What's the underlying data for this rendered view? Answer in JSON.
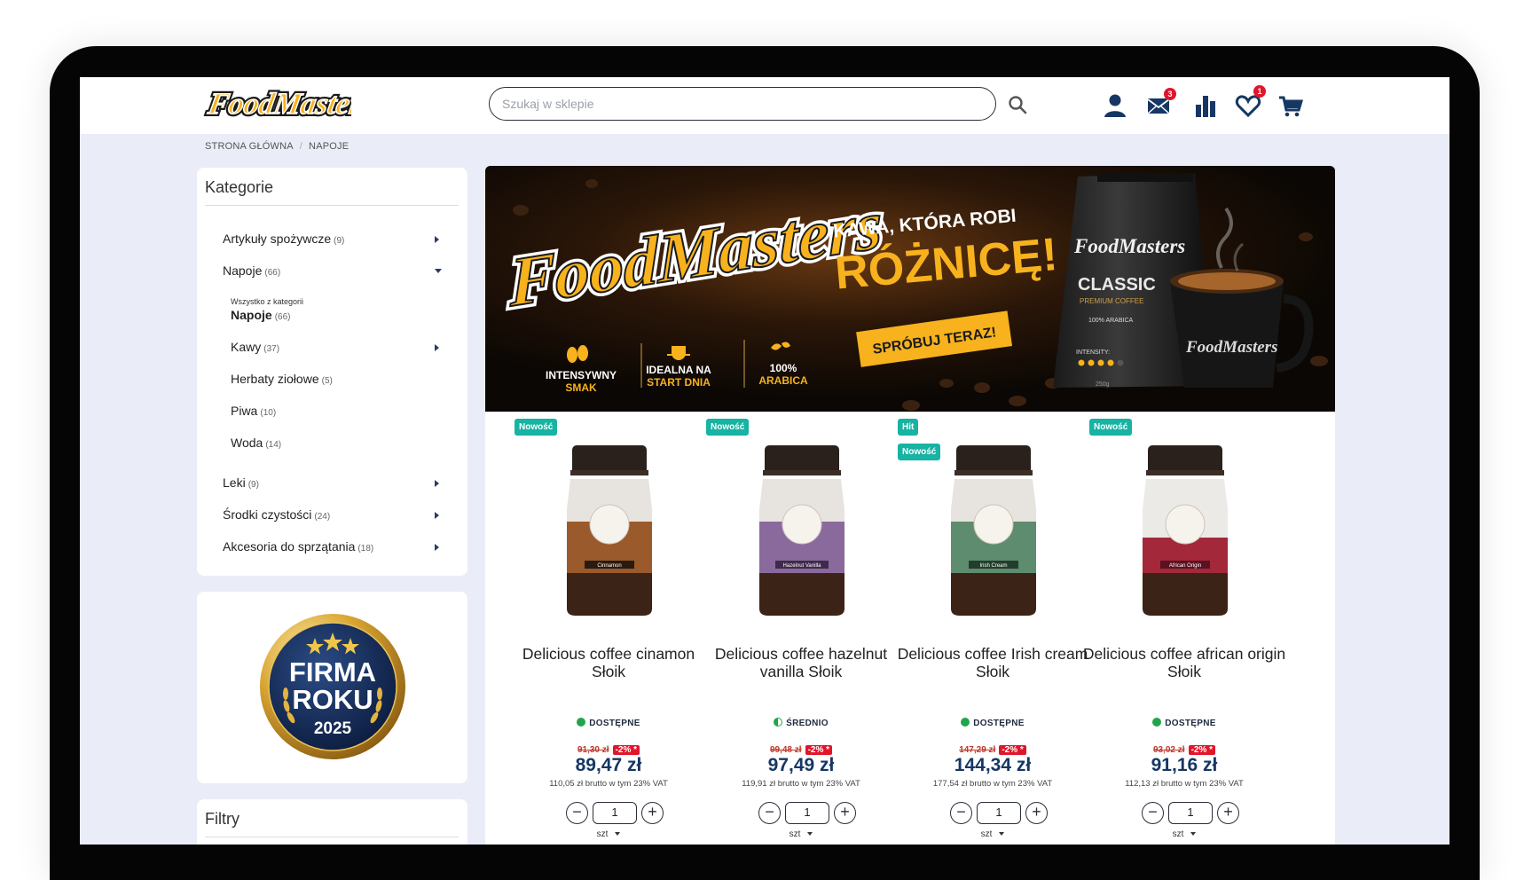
{
  "search": {
    "placeholder": "Szukaj w sklepie"
  },
  "header": {
    "icons": [
      "user-icon",
      "envelope-icon",
      "chart-icon",
      "heart-icon",
      "cart-icon"
    ],
    "messages_count": "3",
    "wishlist_count": "1"
  },
  "breadcrumb": {
    "home": "STRONA GŁÓWNA",
    "current": "NAPOJE"
  },
  "sidebar": {
    "title": "Kategorie",
    "categories": [
      {
        "label": "Artykuły spożywcze",
        "count": "(9)"
      },
      {
        "label": "Napoje",
        "count": "(66)"
      },
      {
        "label": "Leki",
        "count": "(9)"
      },
      {
        "label": "Środki czystości",
        "count": "(24)"
      },
      {
        "label": "Akcesoria do sprzątania",
        "count": "(18)"
      }
    ],
    "all_in_category": "Wszystko z kategorii",
    "all_name": "Napoje",
    "all_count": "(66)",
    "subcategories": [
      {
        "label": "Kawy",
        "count": "(37)"
      },
      {
        "label": "Herbaty ziołowe",
        "count": "(5)"
      },
      {
        "label": "Piwa",
        "count": "(10)"
      },
      {
        "label": "Woda",
        "count": "(14)"
      }
    ],
    "award": {
      "line1": "FIRMA",
      "line2": "ROKU",
      "year": "2025"
    },
    "filters_title": "Filtry"
  },
  "banner": {
    "logo": "FoodMasters",
    "headline1": "KAWA, KTÓRA ROBI",
    "headline2": "RÓŻNICĘ!",
    "cta": "SPRÓBUJ TERAZ!",
    "features": [
      {
        "line1": "INTENSYWNY",
        "line2": "SMAK"
      },
      {
        "line1": "IDEALNA NA",
        "line2": "START DNIA"
      },
      {
        "line1": "100%",
        "line2": "ARABICA"
      }
    ],
    "bag_brand": "FoodMasters",
    "bag_title": "CLASSIC",
    "bag_sub": "PREMIUM COFFEE",
    "bag_arabica": "100% ARABICA",
    "bag_intensity": "INTENSITY:",
    "bag_weight": "250g"
  },
  "products": [
    {
      "tags": [
        "Nowość"
      ],
      "name": "Delicious coffee cinamon Słoik",
      "availability": "DOSTĘPNE",
      "avail_color": "#1fa64a",
      "old_price": "91,30 zł",
      "discount": "-2% *",
      "price": "89,47 zł",
      "gross": "110,05 zł brutto w tym 23% VAT",
      "qty": "1",
      "unit": "szt",
      "jar_label": "Cinnamon",
      "jar_color": "#9a5a2b"
    },
    {
      "tags": [
        "Nowość"
      ],
      "name": "Delicious coffee hazelnut vanilla Słoik",
      "availability": "ŚREDNIO",
      "avail_color": "#1fa64a",
      "old_price": "99,48 zł",
      "discount": "-2% *",
      "price": "97,49 zł",
      "gross": "119,91 zł brutto w tym 23% VAT",
      "qty": "1",
      "unit": "szt",
      "jar_label": "Hazelnut Vanilla",
      "jar_color": "#8a6a9c"
    },
    {
      "tags": [
        "Hit",
        "Nowość"
      ],
      "name": "Delicious coffee Irish cream Słoik",
      "availability": "DOSTĘPNE",
      "avail_color": "#1fa64a",
      "old_price": "147,29 zł",
      "discount": "-2% *",
      "price": "144,34 zł",
      "gross": "177,54 zł brutto w tym 23% VAT",
      "qty": "1",
      "unit": "szt",
      "jar_label": "Irish Cream",
      "jar_color": "#5e8c6e"
    },
    {
      "tags": [
        "Nowość"
      ],
      "name": "Delicious coffee african origin Słoik",
      "availability": "DOSTĘPNE",
      "avail_color": "#1fa64a",
      "old_price": "93,02 zł",
      "discount": "-2% *",
      "price": "91,16 zł",
      "gross": "112,13 zł brutto w tym 23% VAT",
      "qty": "1",
      "unit": "szt",
      "jar_label": "African Origin",
      "jar_color": "#a3283a"
    }
  ]
}
